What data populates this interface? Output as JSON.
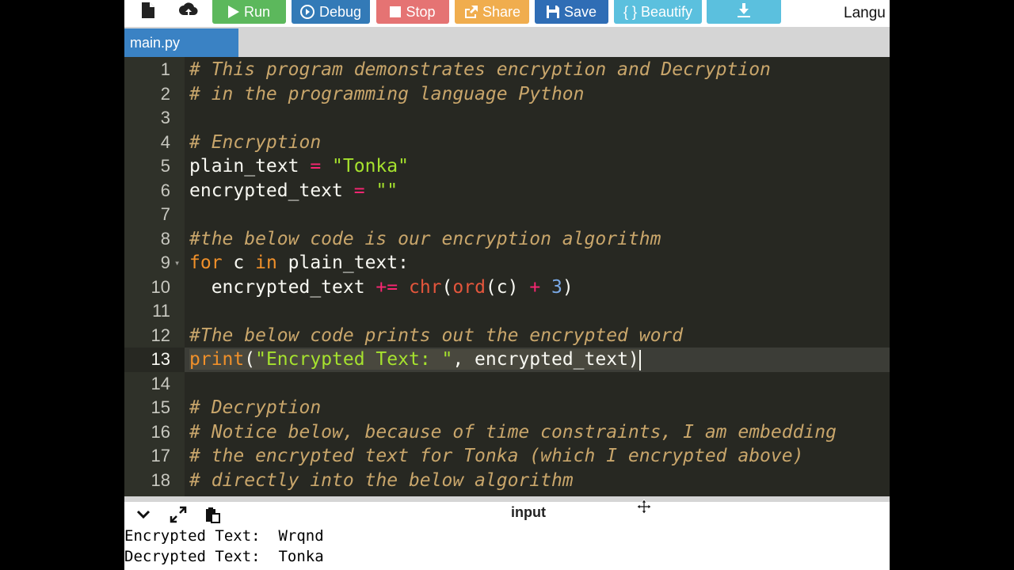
{
  "toolbar": {
    "buttons": [
      {
        "label": "",
        "icon": "new-file-icon",
        "color": "#ffffff"
      },
      {
        "label": "",
        "icon": "upload-cloud-icon",
        "color": "#ffffff"
      },
      {
        "label": "Run",
        "icon": "play-icon",
        "color": "#5cb85c"
      },
      {
        "label": "Debug",
        "icon": "debug-circle-icon",
        "color": "#337ab7"
      },
      {
        "label": "Stop",
        "icon": "stop-square-icon",
        "color": "#e57373"
      },
      {
        "label": "Share",
        "icon": "share-icon",
        "color": "#f0ad4e"
      },
      {
        "label": "Save",
        "icon": "save-disk-icon",
        "color": "#2f6db5"
      },
      {
        "label": "{ } Beautify",
        "icon": "",
        "color": "#5bc0de"
      },
      {
        "label": "",
        "icon": "download-icon",
        "color": "#5bc0de"
      }
    ],
    "language_label": "Langu"
  },
  "tabs": [
    {
      "label": "main.py"
    }
  ],
  "editor": {
    "lines": [
      {
        "n": "1",
        "code": "# This program demonstrates encryption and Decryption"
      },
      {
        "n": "2",
        "code": "# in the programming language Python"
      },
      {
        "n": "3",
        "code": ""
      },
      {
        "n": "4",
        "code": "# Encryption"
      },
      {
        "n": "5",
        "code": "plain_text = \"Tonka\""
      },
      {
        "n": "6",
        "code": "encrypted_text = \"\""
      },
      {
        "n": "7",
        "code": ""
      },
      {
        "n": "8",
        "code": "#the below code is our encryption algorithm"
      },
      {
        "n": "9",
        "code": "for c in plain_text:"
      },
      {
        "n": "10",
        "code": "  encrypted_text += chr(ord(c) + 3)"
      },
      {
        "n": "11",
        "code": ""
      },
      {
        "n": "12",
        "code": "#The below code prints out the encrypted word"
      },
      {
        "n": "13",
        "code": "print(\"Encrypted Text: \", encrypted_text)"
      },
      {
        "n": "14",
        "code": ""
      },
      {
        "n": "15",
        "code": "# Decryption"
      },
      {
        "n": "16",
        "code": "# Notice below, because of time constraints, I am embedding"
      },
      {
        "n": "17",
        "code": "# the encrypted text for Tonka (which I encrypted above)"
      },
      {
        "n": "18",
        "code": "# directly into the below algorithm"
      }
    ],
    "active_line": 13
  },
  "output": {
    "label": "input",
    "console_lines": [
      "Encrypted Text:  Wrqnd",
      "Decrypted Text:  Tonka"
    ]
  }
}
